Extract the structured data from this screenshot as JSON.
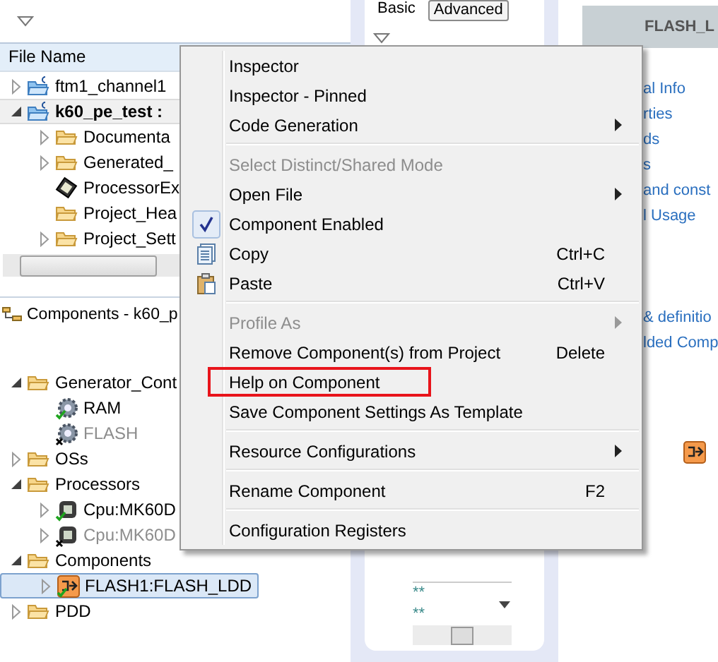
{
  "explorer": {
    "header": "File Name",
    "tree": [
      {
        "label": "ftm1_channel1",
        "kind": "project",
        "expandable": true,
        "expanded": false,
        "selected": false,
        "disabled": false
      },
      {
        "label": "k60_pe_test  :",
        "kind": "project",
        "expandable": true,
        "expanded": true,
        "selected": true,
        "disabled": false,
        "children": [
          {
            "label": "Documenta",
            "kind": "folder",
            "expandable": true,
            "expanded": false,
            "selected": false,
            "disabled": false
          },
          {
            "label": "Generated_",
            "kind": "folder",
            "expandable": true,
            "expanded": false,
            "selected": false,
            "disabled": false
          },
          {
            "label": "ProcessorEx",
            "kind": "chip",
            "expandable": false,
            "selected": false,
            "disabled": false
          },
          {
            "label": "Project_Hea",
            "kind": "folder",
            "expandable": false,
            "selected": false,
            "disabled": false
          },
          {
            "label": "Project_Sett",
            "kind": "folder",
            "expandable": true,
            "expanded": false,
            "selected": false,
            "disabled": false
          }
        ]
      }
    ]
  },
  "components_view": {
    "title": "Components - k60_p",
    "tree": [
      {
        "label": "Generator_Cont",
        "kind": "folder",
        "expandable": true,
        "expanded": true,
        "selected": false,
        "disabled": false,
        "children": [
          {
            "label": "RAM",
            "kind": "gear",
            "expandable": false,
            "selected": false,
            "disabled": false
          },
          {
            "label": "FLASH",
            "kind": "gear",
            "expandable": false,
            "selected": false,
            "disabled": true
          }
        ]
      },
      {
        "label": "OSs",
        "kind": "folder",
        "expandable": true,
        "expanded": false,
        "selected": false,
        "disabled": false
      },
      {
        "label": "Processors",
        "kind": "folder",
        "expandable": true,
        "expanded": true,
        "selected": false,
        "disabled": false,
        "children": [
          {
            "label": "Cpu:MK60D",
            "kind": "cpu",
            "expandable": true,
            "expanded": false,
            "selected": false,
            "disabled": false
          },
          {
            "label": "Cpu:MK60D",
            "kind": "cpu",
            "expandable": true,
            "expanded": false,
            "selected": false,
            "disabled": true
          }
        ]
      },
      {
        "label": "Components",
        "kind": "folder",
        "expandable": true,
        "expanded": true,
        "selected": false,
        "disabled": false,
        "children": [
          {
            "label": "FLASH1:FLASH_LDD",
            "kind": "component",
            "expandable": true,
            "expanded": false,
            "selected": true,
            "disabled": false
          }
        ]
      },
      {
        "label": "PDD",
        "kind": "folder",
        "expandable": true,
        "expanded": false,
        "selected": false,
        "disabled": false
      }
    ]
  },
  "inspector": {
    "tabs": [
      {
        "label": "Basic",
        "selected": false
      },
      {
        "label": "Advanced",
        "selected": true
      }
    ],
    "code_lines": [
      "**",
      "**"
    ]
  },
  "help_page": {
    "title": "FLASH_L",
    "link_groups": [
      [
        "al Info",
        "rties",
        "ds",
        "s",
        "and const",
        "l Usage"
      ],
      [
        "& definitio",
        "lded Comp"
      ]
    ]
  },
  "context_menu": [
    {
      "kind": "item",
      "label": "Inspector",
      "disabled": false,
      "checked": false,
      "submenu": false
    },
    {
      "kind": "item",
      "label": "Inspector - Pinned",
      "disabled": false,
      "checked": false,
      "submenu": false
    },
    {
      "kind": "item",
      "label": "Code Generation",
      "disabled": false,
      "checked": false,
      "submenu": true
    },
    {
      "kind": "separator"
    },
    {
      "kind": "item",
      "label": "Select Distinct/Shared Mode",
      "disabled": true,
      "checked": false,
      "submenu": false
    },
    {
      "kind": "item",
      "label": "Open File",
      "disabled": false,
      "checked": false,
      "submenu": true
    },
    {
      "kind": "item",
      "label": "Component Enabled",
      "disabled": false,
      "checked": true,
      "submenu": false
    },
    {
      "kind": "copy",
      "label": "Copy",
      "shortcut": "Ctrl+C",
      "disabled": false,
      "checked": false,
      "submenu": false
    },
    {
      "kind": "paste",
      "label": "Paste",
      "shortcut": "Ctrl+V",
      "disabled": false,
      "checked": false,
      "submenu": false
    },
    {
      "kind": "separator"
    },
    {
      "kind": "item",
      "label": "Profile As",
      "disabled": true,
      "checked": false,
      "submenu": true
    },
    {
      "kind": "item",
      "label": "Remove Component(s) from Project",
      "shortcut": "Delete",
      "disabled": false,
      "checked": false,
      "submenu": false
    },
    {
      "kind": "boxed",
      "label": "Help on Component",
      "disabled": false,
      "checked": false,
      "submenu": false
    },
    {
      "kind": "item",
      "label": "Save Component Settings As Template",
      "disabled": false,
      "checked": false,
      "submenu": false
    },
    {
      "kind": "separator"
    },
    {
      "kind": "item",
      "label": "Resource Configurations",
      "disabled": false,
      "checked": false,
      "submenu": true
    },
    {
      "kind": "separator"
    },
    {
      "kind": "item",
      "label": "Rename Component",
      "shortcut": "F2",
      "disabled": false,
      "checked": false,
      "submenu": false
    },
    {
      "kind": "separator"
    },
    {
      "kind": "item",
      "label": "Configuration Registers",
      "disabled": false,
      "checked": false,
      "submenu": false
    }
  ]
}
